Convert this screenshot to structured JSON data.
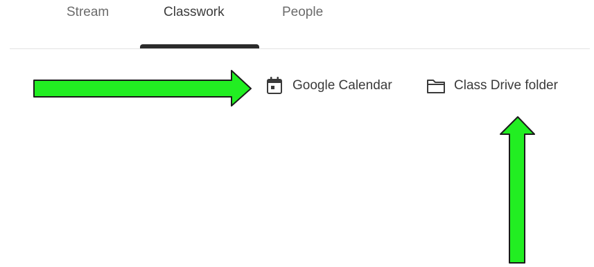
{
  "tabs": {
    "stream": "Stream",
    "classwork": "Classwork",
    "people": "People"
  },
  "actions": {
    "calendar_label": "Google Calendar",
    "drive_label": "Class Drive folder"
  },
  "icons": {
    "calendar": "calendar-icon",
    "folder": "folder-icon"
  },
  "colors": {
    "arrow_fill": "#22ee22",
    "active_indicator": "#2b2b2b"
  }
}
